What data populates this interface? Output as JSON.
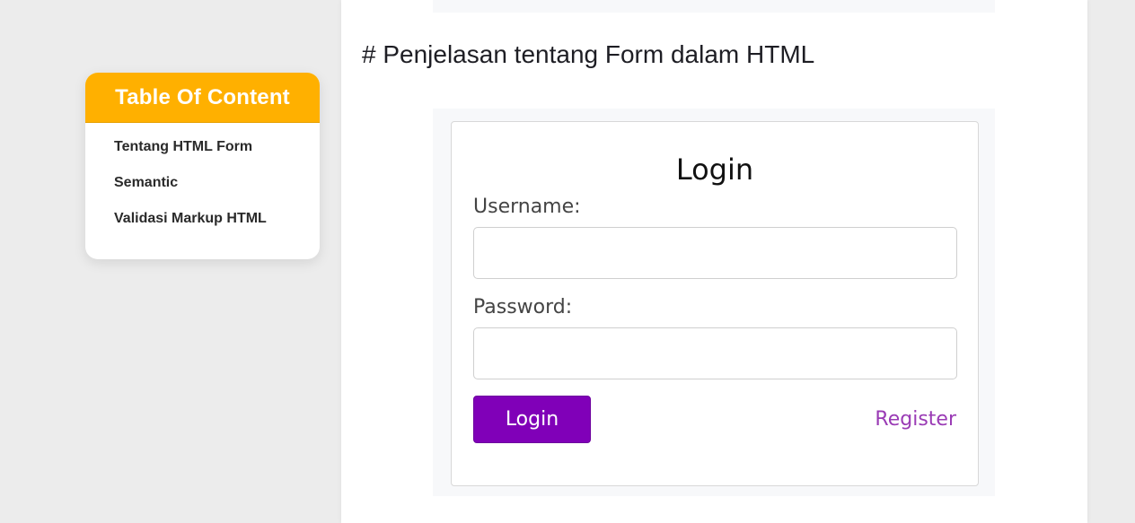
{
  "toc": {
    "title": "Table Of Content",
    "items": [
      {
        "label": "Tentang HTML Form"
      },
      {
        "label": "Semantic"
      },
      {
        "label": "Validasi Markup HTML"
      }
    ],
    "accent_color": "#ffb000"
  },
  "article": {
    "heading": "# Penjelasan tentang Form dalam HTML"
  },
  "login_image": {
    "title": "Login",
    "username_label": "Username:",
    "password_label": "Password:",
    "login_button_label": "Login",
    "register_label": "Register",
    "button_color": "#8000b8",
    "link_color": "#9a3bb5"
  }
}
